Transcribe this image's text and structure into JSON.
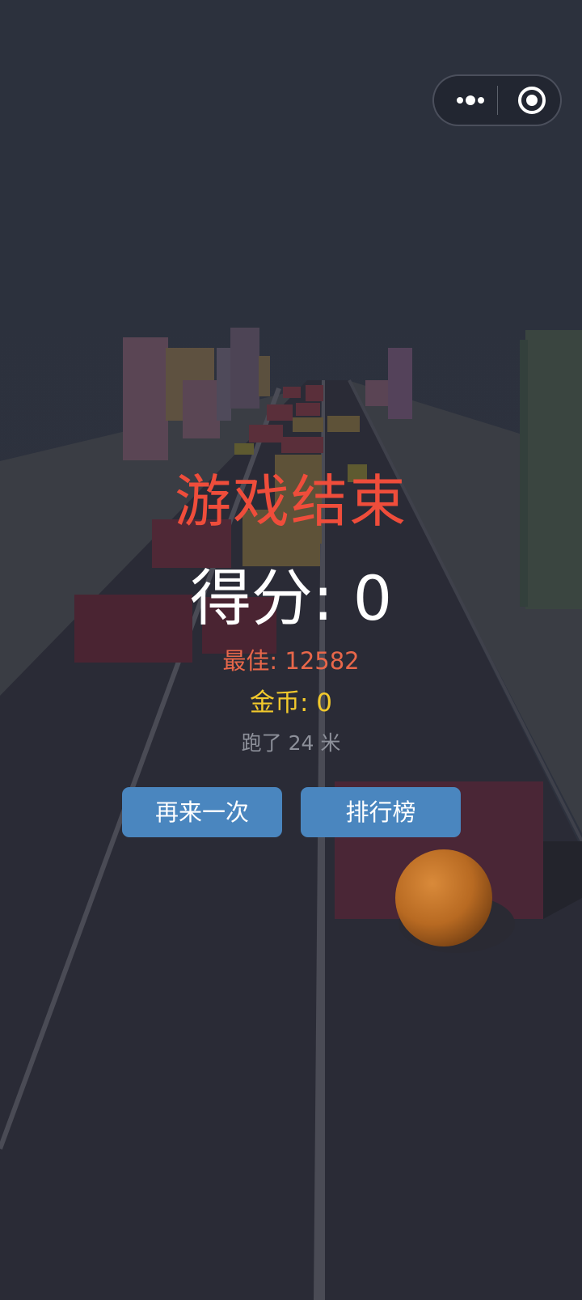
{
  "game_over": {
    "title": "游戏结束",
    "score_text": "得分: 0",
    "best_text": "最佳: 12582",
    "coins_text": "金币: 0",
    "distance_text": "跑了 24 米"
  },
  "buttons": {
    "retry_label": "再来一次",
    "leaderboard_label": "排行榜"
  },
  "capsule": {
    "more_icon": "more-dots-icon",
    "close_icon": "target-close-icon"
  },
  "colors": {
    "background": "#2b2e3b",
    "title": "#ef4d3b",
    "best": "#e8674a",
    "coins": "#f2c92c",
    "distance": "#8d909a",
    "button": "#4a86bf",
    "ball": "#c6772a"
  }
}
